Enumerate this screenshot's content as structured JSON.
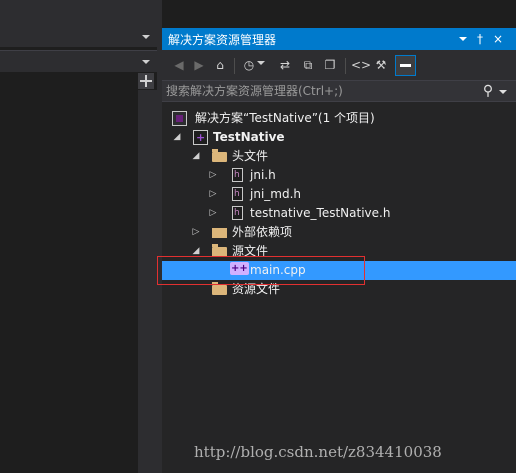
{
  "panel": {
    "title": "解决方案资源管理器",
    "pin_glyph": "†",
    "close_glyph": "×"
  },
  "toolbar": {
    "icons": [
      "back-icon",
      "forward-icon",
      "home-icon",
      "history-icon",
      "sync-icon",
      "collapse-all-icon",
      "show-all-files-icon",
      "view-code-icon",
      "properties-icon",
      "preview-icon"
    ]
  },
  "search": {
    "placeholder": "搜索解决方案资源管理器(Ctrl+;)"
  },
  "tree": {
    "solution": "解决方案“TestNative”(1 个项目)",
    "project": "TestNative",
    "header_files_folder": "头文件",
    "header_files": [
      "jni.h",
      "jni_md.h",
      "testnative_TestNative.h"
    ],
    "external_deps_folder": "外部依赖项",
    "source_files_folder": "源文件",
    "source_files": [
      "main.cpp"
    ],
    "resource_files_folder": "资源文件"
  },
  "watermark": "http://blog.csdn.net/z834410038",
  "colors": {
    "accent": "#007acc",
    "selection": "#3399ff",
    "highlight_box": "#e23030"
  }
}
